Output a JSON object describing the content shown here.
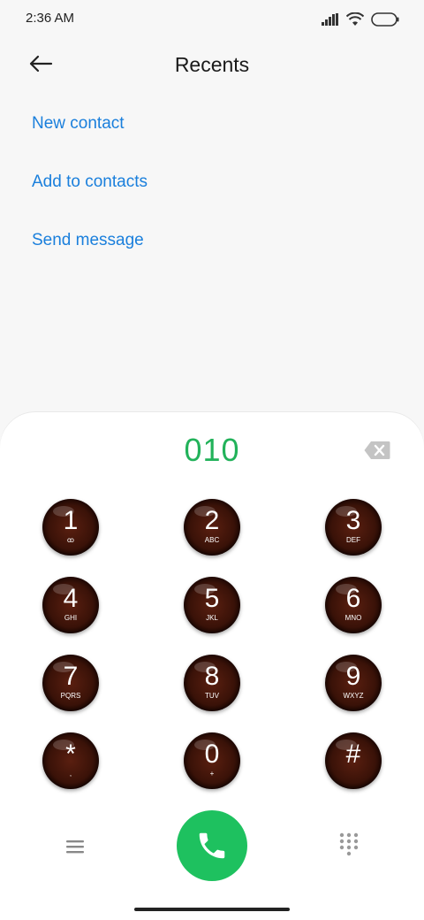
{
  "status_bar": {
    "time": "2:36 AM",
    "icons": [
      "signal-icon",
      "wifi-icon",
      "battery-icon"
    ]
  },
  "header": {
    "title": "Recents",
    "back_icon": "arrow-left-icon"
  },
  "actions": [
    {
      "label": "New contact"
    },
    {
      "label": "Add to contacts"
    },
    {
      "label": "Send message"
    }
  ],
  "dialer": {
    "number": "010",
    "backspace_icon": "backspace-icon",
    "keys": [
      {
        "digit": "1",
        "letters": "ꝏ"
      },
      {
        "digit": "2",
        "letters": "ABC"
      },
      {
        "digit": "3",
        "letters": "DEF"
      },
      {
        "digit": "4",
        "letters": "GHI"
      },
      {
        "digit": "5",
        "letters": "JKL"
      },
      {
        "digit": "6",
        "letters": "MNO"
      },
      {
        "digit": "7",
        "letters": "PQRS"
      },
      {
        "digit": "8",
        "letters": "TUV"
      },
      {
        "digit": "9",
        "letters": "WXYZ"
      },
      {
        "digit": "*",
        "letters": ","
      },
      {
        "digit": "0",
        "letters": "+"
      },
      {
        "digit": "#",
        "letters": ""
      }
    ],
    "bottom": {
      "menu_icon": "menu-icon",
      "call_icon": "phone-icon",
      "keypad_icon": "keypad-icon"
    }
  },
  "colors": {
    "link": "#1a7fdc",
    "number": "#22b25a",
    "call_button": "#1ec15f"
  }
}
